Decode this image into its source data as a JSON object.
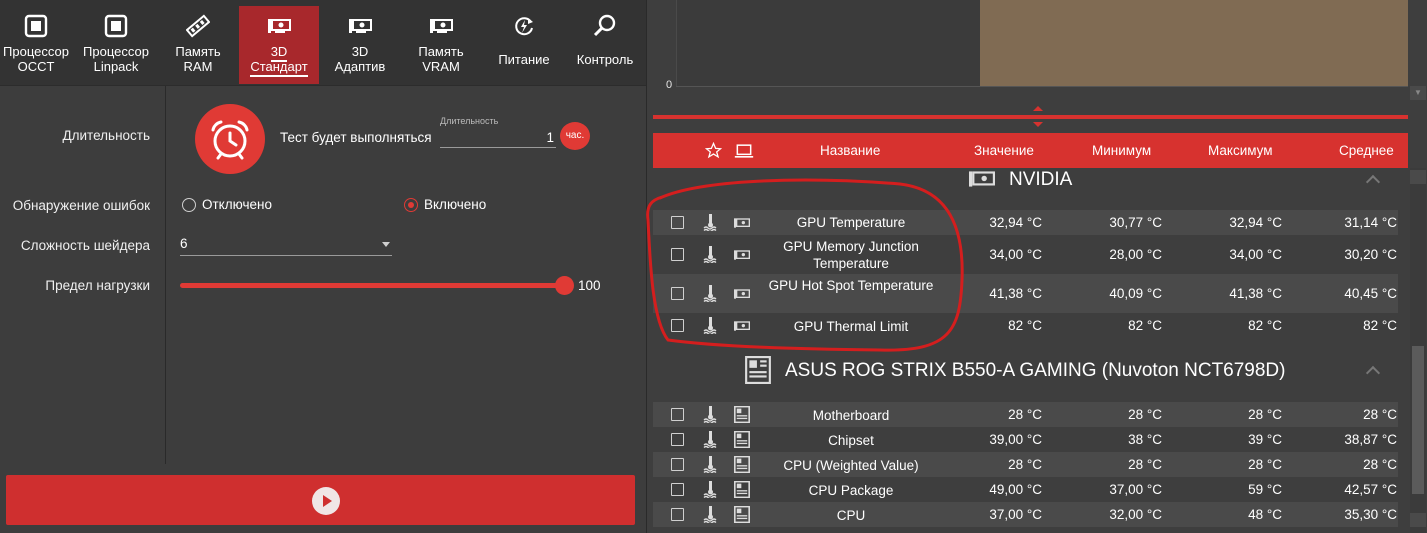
{
  "tabs": [
    {
      "label": "Процессор\nOCCT",
      "icon": "cpu-chip-icon"
    },
    {
      "label": "Процессор\nLinpack",
      "icon": "cpu-chip-icon"
    },
    {
      "label": "Память\nRAM",
      "icon": "ram-stick-icon"
    },
    {
      "label": "3D\nСтандарт",
      "icon": "gpu-card-icon",
      "active": true
    },
    {
      "label": "3D\nАдаптив",
      "icon": "gpu-card-icon"
    },
    {
      "label": "Память\nVRAM",
      "icon": "gpu-card-icon"
    },
    {
      "label": "Питание",
      "icon": "power-cycle-icon"
    },
    {
      "label": "Контроль",
      "icon": "magnifier-icon"
    }
  ],
  "settings": {
    "duration_label": "Длительность",
    "duration_text": "Тест будет выполняться",
    "duration_field_label": "Длительность",
    "duration_value": "1",
    "duration_unit": "час.",
    "error_detection_label": "Обнаружение ошибок",
    "error_off": "Отключено",
    "error_on": "Включено",
    "error_selected": "on",
    "shader_label": "Сложность шейдера",
    "shader_value": "6",
    "load_limit_label": "Предел нагрузки",
    "load_limit_value": "100",
    "load_limit_fraction": 1.0
  },
  "chart": {
    "zero_label": "0"
  },
  "table": {
    "headers": {
      "name": "Название",
      "value": "Значение",
      "min": "Минимум",
      "max": "Максимум",
      "avg": "Среднее"
    },
    "groups": [
      {
        "name": "NVIDIA",
        "icon": "gpu-card-icon",
        "rows": [
          {
            "name": "GPU Temperature",
            "value": "32,94 °C",
            "min": "30,77 °C",
            "max": "32,94 °C",
            "avg": "31,14 °C"
          },
          {
            "name": "GPU Memory Junction Temperature",
            "value": "34,00 °C",
            "min": "28,00 °C",
            "max": "34,00 °C",
            "avg": "30,20 °C"
          },
          {
            "name": "GPU Hot Spot Temperature",
            "value": "41,38 °C",
            "min": "40,09 °C",
            "max": "41,38 °C",
            "avg": "40,45 °C"
          },
          {
            "name": "GPU Thermal Limit",
            "value": "82 °C",
            "min": "82 °C",
            "max": "82 °C",
            "avg": "82 °C"
          }
        ]
      },
      {
        "name": "ASUS ROG STRIX B550-A GAMING (Nuvoton NCT6798D)",
        "icon": "motherboard-icon",
        "rows": [
          {
            "name": "Motherboard",
            "value": "28 °C",
            "min": "28 °C",
            "max": "28 °C",
            "avg": "28 °C"
          },
          {
            "name": "Chipset",
            "value": "39,00 °C",
            "min": "38 °C",
            "max": "39 °C",
            "avg": "38,87 °C"
          },
          {
            "name": "CPU (Weighted Value)",
            "value": "28 °C",
            "min": "28 °C",
            "max": "28 °C",
            "avg": "28 °C"
          },
          {
            "name": "CPU Package",
            "value": "49,00 °C",
            "min": "37,00 °C",
            "max": "59 °C",
            "avg": "42,57 °C"
          },
          {
            "name": "CPU",
            "value": "37,00 °C",
            "min": "32,00 °C",
            "max": "48 °C",
            "avg": "35,30 °C"
          }
        ]
      }
    ]
  },
  "colors": {
    "accent": "#d7322f",
    "active_tab": "#a8282c",
    "annotation": "#d41e1e",
    "chart_fill": "#806b53"
  }
}
